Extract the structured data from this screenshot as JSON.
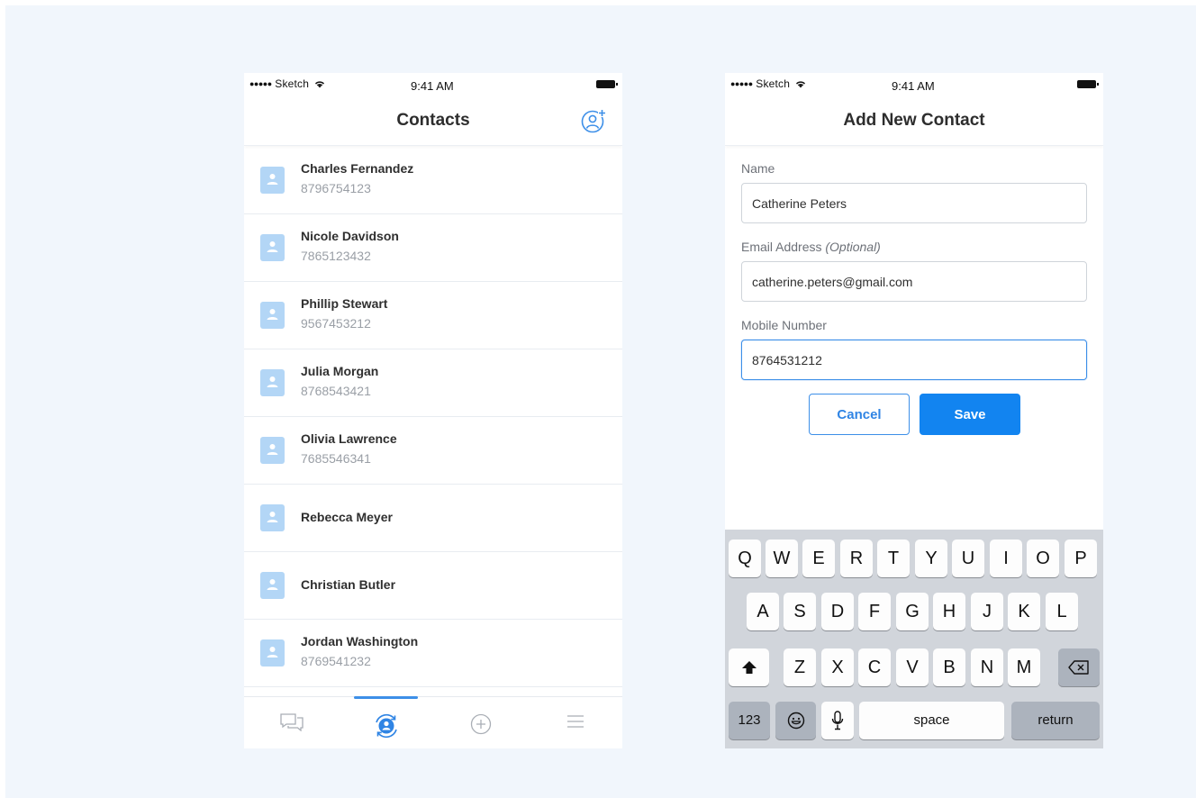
{
  "status_bar": {
    "carrier_dots": "●●●●●",
    "carrier": "Sketch",
    "time": "9:41 AM"
  },
  "contacts_screen": {
    "title": "Contacts",
    "contacts": [
      {
        "name": "Charles Fernandez",
        "phone": "8796754123"
      },
      {
        "name": "Nicole Davidson",
        "phone": "7865123432"
      },
      {
        "name": "Phillip Stewart",
        "phone": "9567453212"
      },
      {
        "name": "Julia Morgan",
        "phone": "8768543421"
      },
      {
        "name": "Olivia Lawrence",
        "phone": "7685546341"
      },
      {
        "name": "Rebecca Meyer",
        "phone": ""
      },
      {
        "name": "Christian Butler",
        "phone": ""
      },
      {
        "name": "Jordan Washington",
        "phone": "8769541232"
      }
    ],
    "tabs": [
      {
        "icon": "chat-icon",
        "active": false
      },
      {
        "icon": "contacts-sync-icon",
        "active": true
      },
      {
        "icon": "add-circle-icon",
        "active": false
      },
      {
        "icon": "menu-icon",
        "active": false
      }
    ]
  },
  "add_contact_screen": {
    "title": "Add New Contact",
    "name_label": "Name",
    "name_value": "Catherine Peters",
    "email_label": "Email Address ",
    "email_optional": "(Optional)",
    "email_value": "catherine.peters@gmail.com",
    "mobile_label": "Mobile Number",
    "mobile_value": "8764531212",
    "cancel_label": "Cancel",
    "save_label": "Save"
  },
  "keyboard": {
    "row1": [
      "Q",
      "W",
      "E",
      "R",
      "T",
      "Y",
      "U",
      "I",
      "O",
      "P"
    ],
    "row2": [
      "A",
      "S",
      "D",
      "F",
      "G",
      "H",
      "J",
      "K",
      "L"
    ],
    "row3": [
      "Z",
      "X",
      "C",
      "V",
      "B",
      "N",
      "M"
    ],
    "numbers_key": "123",
    "space_key": "space",
    "return_key": "return"
  },
  "colors": {
    "accent": "#1284f0",
    "avatar_bg": "#b3d6f6",
    "background": "#f1f6fc",
    "keyboard_bg": "#d1d5db"
  }
}
